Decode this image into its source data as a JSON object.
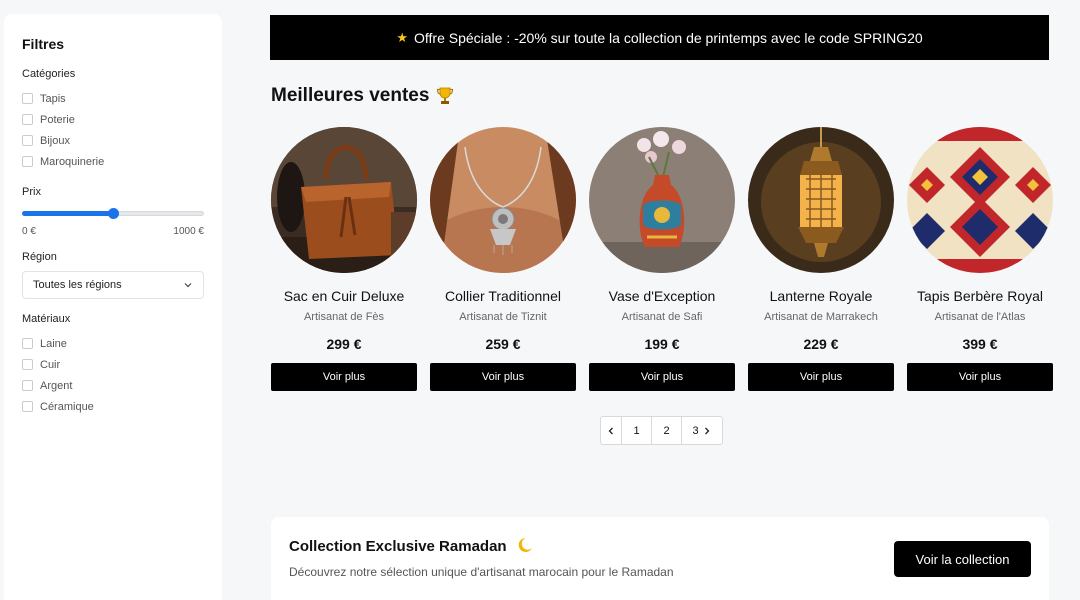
{
  "filters": {
    "title": "Filtres",
    "categories_label": "Catégories",
    "categories": [
      "Tapis",
      "Poterie",
      "Bijoux",
      "Maroquinerie"
    ],
    "price_label": "Prix",
    "price_min": "0 €",
    "price_max": "1000 €",
    "price_slider_fraction": 0.5,
    "region_label": "Région",
    "region_selected": "Toutes les régions",
    "materials_label": "Matériaux",
    "materials": [
      "Laine",
      "Cuir",
      "Argent",
      "Céramique"
    ]
  },
  "promo": {
    "star": "★",
    "text": "Offre Spéciale : -20% sur toute la collection de printemps avec le code SPRING20"
  },
  "bestsellers": {
    "title": "Meilleures ventes",
    "icon": "trophy-icon",
    "products": [
      {
        "name": "Sac en Cuir Deluxe",
        "origin": "Artisanat de Fès",
        "price": "299 €",
        "button": "Voir plus",
        "image": "leather-bag"
      },
      {
        "name": "Collier Traditionnel",
        "origin": "Artisanat de Tiznit",
        "price": "259 €",
        "button": "Voir plus",
        "image": "necklace"
      },
      {
        "name": "Vase d'Exception",
        "origin": "Artisanat de Safi",
        "price": "199 €",
        "button": "Voir plus",
        "image": "vase"
      },
      {
        "name": "Lanterne Royale",
        "origin": "Artisanat de Marrakech",
        "price": "229 €",
        "button": "Voir plus",
        "image": "lantern"
      },
      {
        "name": "Tapis Berbère Royal",
        "origin": "Artisanat de l'Atlas",
        "price": "399 €",
        "button": "Voir plus",
        "image": "rug"
      }
    ]
  },
  "pagination": {
    "pages": [
      "1",
      "2",
      "3"
    ]
  },
  "ramadan": {
    "title": "Collection Exclusive Ramadan",
    "description": "Découvrez notre sélection unique d'artisanat marocain pour le Ramadan",
    "button": "Voir la collection"
  },
  "colors": {
    "accent": "#1a73e8",
    "primary_button": "#000000",
    "star": "#f5c518"
  }
}
